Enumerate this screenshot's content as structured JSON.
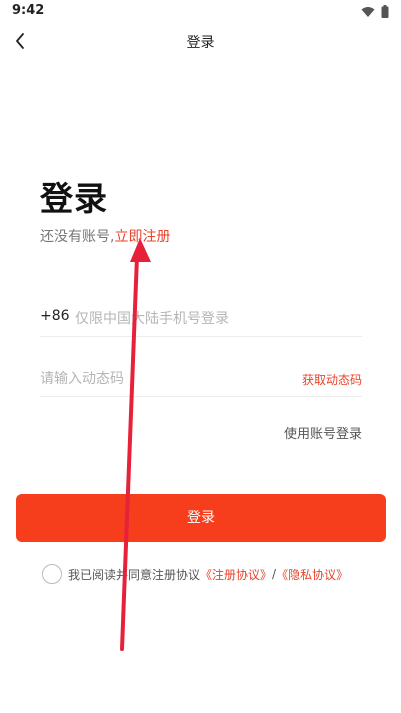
{
  "status_bar": {
    "time": "9:42",
    "icons": [
      "wifi-icon",
      "battery-icon"
    ]
  },
  "nav": {
    "title": "登录",
    "back_icon": "back-arrow-icon"
  },
  "login": {
    "heading": "登录",
    "no_account_text": "还没有账号,",
    "register_link": "立即注册",
    "phone_prefix": "+86",
    "phone_placeholder": "仅限中国大陆手机号登录",
    "code_placeholder": "请输入动态码",
    "get_code_label": "获取动态码",
    "account_login_label": "使用账号登录",
    "submit_label": "登录"
  },
  "agreement": {
    "text": "我已阅读并同意注册协议",
    "register_agreement": "《注册协议》",
    "separator": "/",
    "privacy_agreement": "《隐私协议》"
  },
  "colors": {
    "accent": "#f63d1c",
    "link": "#e8432a",
    "annotation_arrow": "#e8213a"
  }
}
